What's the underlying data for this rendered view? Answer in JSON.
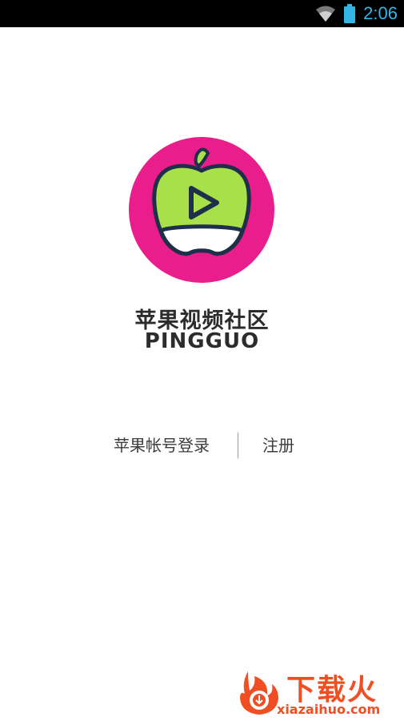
{
  "status_bar": {
    "time": "2:06",
    "icons": [
      "wifi-icon",
      "battery-icon"
    ],
    "color": "#33b5e5"
  },
  "logo": {
    "icon": "apple-play-logo",
    "circle_color": "#e91e8c",
    "apple_color": "#a8e04a"
  },
  "app": {
    "name": "苹果视频社区",
    "name_en": "PINGGUO"
  },
  "auth": {
    "login_label": "苹果帐号登录",
    "register_label": "注册"
  },
  "watermark": {
    "text_cn": "下载火",
    "text_en": "xiazaihuo.com",
    "color": "#f04e23"
  }
}
